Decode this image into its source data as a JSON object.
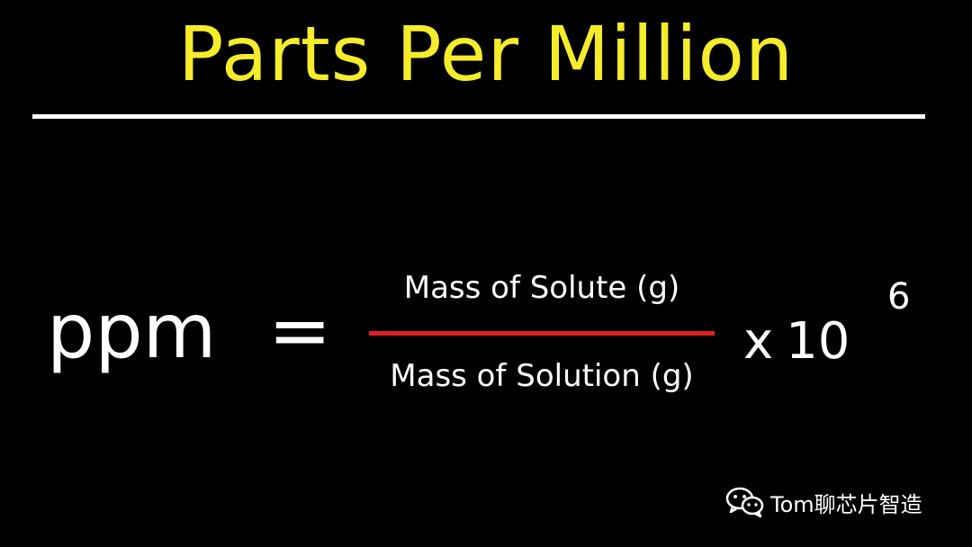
{
  "title": "Parts Per Million",
  "equation": {
    "lhs": "ppm",
    "equals": "=",
    "numerator": "Mass of Solute (g)",
    "denominator": "Mass of Solution (g)",
    "times": "x",
    "base": "10",
    "exponent": "6"
  },
  "watermark": {
    "icon": "wechat-icon",
    "text": "Tom聊芯片智造"
  },
  "colors": {
    "background": "#000000",
    "title": "#f5ec2a",
    "text": "#ffffff",
    "fraction_bar": "#e02020"
  }
}
